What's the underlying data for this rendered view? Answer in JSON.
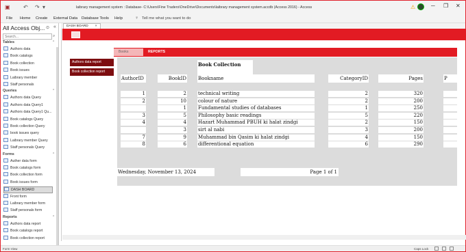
{
  "titlebar": {
    "title": "laibrary management system : Database- C:\\Users\\Fine Traders\\OneDrive\\Documents\\laibrary management system.accdb (Access 2016)  -  Access",
    "save_icon": "save-icon",
    "undo_icon": "undo-icon",
    "redo_icon": "redo-icon",
    "warning_icon": "warning-icon",
    "minimize": "─",
    "restore": "❐",
    "close": "✕"
  },
  "menu": {
    "items": [
      "File",
      "Home",
      "Create",
      "External Data",
      "Database Tools",
      "Help"
    ],
    "tell_me": "Tell me what you want to do"
  },
  "nav": {
    "header": "All Access Obj...",
    "search_placeholder": "Search...",
    "sections": [
      {
        "title": "Tables",
        "items": [
          "Authors data",
          "Book catalogs",
          "Book collection",
          "Book issues",
          "Laibrary member",
          "Staff personals"
        ]
      },
      {
        "title": "Queries",
        "items": [
          "Authors data Query",
          "Authors data Query1",
          "Authors data Query1 Qu...",
          "Book catalogs Query",
          "Book collection Query",
          "book issues query",
          "Laibrary member Query",
          "Staff personals Query"
        ]
      },
      {
        "title": "Forms",
        "items": [
          "Auther data form",
          "Book catalogs form",
          "Book collection form",
          "Book issues form",
          "DASH BOARD",
          "Front form",
          "Laibrary member form",
          "Staff personals form"
        ]
      },
      {
        "title": "Reports",
        "items": [
          "Authors data report",
          "Book catalogs report",
          "Book collection report"
        ]
      }
    ],
    "selected": "DASH BOARD"
  },
  "doc_tab": {
    "label": "DASH BOARD",
    "close": "×"
  },
  "dashboard": {
    "buttons": [
      "Authors data report",
      "Book collection report"
    ],
    "tabs": [
      "Books",
      "REPORTS"
    ],
    "active_tab": "REPORTS"
  },
  "report": {
    "title": "Book Collection",
    "columns": [
      "AuthorID",
      "BookID",
      "Bookname",
      "CategoryID",
      "Pages",
      "P"
    ],
    "rows": [
      [
        "1",
        "2",
        "technical writing",
        "2",
        "320",
        ""
      ],
      [
        "2",
        "10",
        "colour of nature",
        "2",
        "200",
        ""
      ],
      [
        "",
        "1",
        "Fundamental studies of databases",
        "1",
        "250",
        ""
      ],
      [
        "3",
        "5",
        "Philosophy basic readings",
        "5",
        "220",
        ""
      ],
      [
        "4",
        "4",
        "Hazart Muhammad PBUH ki halat zindgi",
        "2",
        "150",
        ""
      ],
      [
        "",
        "3",
        "sirt al nabi",
        "3",
        "200",
        ""
      ],
      [
        "7",
        "9",
        "Muhammad bin Qasim ki halat zindgi",
        "4",
        "150",
        ""
      ],
      [
        "8",
        "6",
        "differentional equation",
        "6",
        "290",
        ""
      ]
    ],
    "footer_date": "Wednesday, November 13, 2024",
    "footer_page": "Page 1 of 1"
  },
  "status": {
    "left": "Form View",
    "caps": "Caps Lock"
  }
}
